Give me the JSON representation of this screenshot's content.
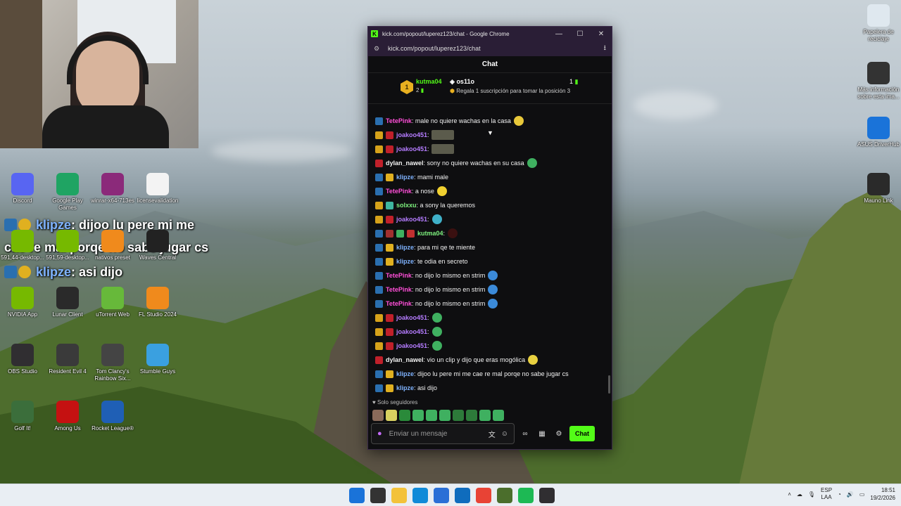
{
  "overlay": {
    "lines": [
      {
        "user": "klipze",
        "text": ": dijoo lu pere mi me"
      },
      {
        "user": "",
        "text": "cae re mal porqe no sabe jugar cs"
      },
      {
        "user": "klipze",
        "text": ": asi dijo"
      }
    ]
  },
  "desktop_icons": {
    "left": [
      {
        "label": "Discord",
        "icon": "discord-icon",
        "color": "#5865f2"
      },
      {
        "label": "Google Play Games",
        "icon": "play-games-icon",
        "color": "#1fa463"
      },
      {
        "label": "winrar-x64-713es",
        "icon": "winrar-icon",
        "color": "#8b2a7a"
      },
      {
        "label": "licensevalidation",
        "icon": "document-icon",
        "color": "#f3f3f3"
      },
      {
        "label": "591,44-desktop...",
        "icon": "nvidia-icon",
        "color": "#76b900"
      },
      {
        "label": "591,59-desktop...",
        "icon": "nvidia-icon",
        "color": "#76b900"
      },
      {
        "label": "nativos preset",
        "icon": "fl-preset-icon",
        "color": "#f08a1c"
      },
      {
        "label": "Waves Central",
        "icon": "waves-icon",
        "color": "#222222"
      },
      {
        "label": "NVIDIA App",
        "icon": "nvidia-icon",
        "color": "#76b900"
      },
      {
        "label": "Lunar Client",
        "icon": "lunar-client-icon",
        "color": "#2a2a2a"
      },
      {
        "label": "uTorrent Web",
        "icon": "utorrent-icon",
        "color": "#67b93a"
      },
      {
        "label": "FL Studio 2024",
        "icon": "fl-studio-icon",
        "color": "#f08a1c"
      },
      {
        "label": "OBS Studio",
        "icon": "obs-icon",
        "color": "#302e31"
      },
      {
        "label": "Resident Evil 4",
        "icon": "re4-icon",
        "color": "#3a3a3a"
      },
      {
        "label": "Tom Clancy's Rainbow Six...",
        "icon": "r6-icon",
        "color": "#444444"
      },
      {
        "label": "Stumble Guys",
        "icon": "stumble-guys-icon",
        "color": "#3aa0e0"
      },
      {
        "label": "Golf It!",
        "icon": "golf-it-icon",
        "color": "#3b6e3b"
      },
      {
        "label": "Among Us",
        "icon": "among-us-icon",
        "color": "#c51111"
      },
      {
        "label": "Rocket League®",
        "icon": "rocket-league-icon",
        "color": "#1f5fb5"
      }
    ],
    "right": [
      {
        "label": "Papelera de reciclaje",
        "icon": "recycle-bin-icon",
        "color": "#dfe8ef"
      },
      {
        "label": "Más información sobre esta ima...",
        "icon": "spotlight-icon",
        "color": "#333333"
      },
      {
        "label": "ASUS DriverHub",
        "icon": "asus-driverhub-icon",
        "color": "#1a73d9"
      },
      {
        "label": "Mauno Link",
        "icon": "mauno-link-icon",
        "color": "#2a2a2a"
      }
    ]
  },
  "browser": {
    "title": "kick.com/popout/luperez123/chat - Google Chrome",
    "url": "kick.com/popout/luperez123/chat",
    "chat_title": "Chat",
    "leaderboard": {
      "first_name": "kutma04",
      "first_count": "2",
      "rank": "1",
      "second_name": "os11o",
      "second_count": "1",
      "promo": "Regala 1 suscripción para tomar la posición 3"
    },
    "messages": [
      {
        "badges": [
          "mod"
        ],
        "user": "TetePink",
        "color": "#ff4fd8",
        "text": ": male no quiere wachas en la casa",
        "emote": "#e8c83a"
      },
      {
        "badges": [
          "crown",
          "gift"
        ],
        "user": "joakoo451",
        "color": "#b57cff",
        "text": ":",
        "emote_sq": true
      },
      {
        "badges": [
          "crown",
          "gift"
        ],
        "user": "joakoo451",
        "color": "#b57cff",
        "text": ":",
        "emote_sq": true
      },
      {
        "badges": [
          "gift"
        ],
        "user": "dylan_nawel",
        "color": "#f2f2f2",
        "text": ": sony no quiere wachas en su casa",
        "emote": "#3fb060"
      },
      {
        "badges": [
          "mod",
          "sub"
        ],
        "user": "klipze",
        "color": "#7fb3ff",
        "text": ": mami male"
      },
      {
        "badges": [
          "mod"
        ],
        "user": "TetePink",
        "color": "#ff4fd8",
        "text": ": a nose",
        "emote": "#f0d030"
      },
      {
        "badges": [
          "crown",
          "og"
        ],
        "user": "solxxu",
        "color": "#7ef27e",
        "text": ": a sony la queremos"
      },
      {
        "badges": [
          "crown",
          "gift"
        ],
        "user": "joakoo451",
        "color": "#b57cff",
        "text": ":",
        "emote": "#3fb0c8"
      },
      {
        "badges": [
          "mod",
          "ring",
          "em",
          "vip"
        ],
        "user": "kutma04",
        "color": "#7ef27e",
        "text": ":",
        "emote": "#3a1010"
      },
      {
        "badges": [
          "mod",
          "sub"
        ],
        "user": "klipze",
        "color": "#7fb3ff",
        "text": ": para mi qe te miente"
      },
      {
        "badges": [
          "mod",
          "sub"
        ],
        "user": "klipze",
        "color": "#7fb3ff",
        "text": ": te odia en secreto"
      },
      {
        "badges": [
          "mod"
        ],
        "user": "TetePink",
        "color": "#ff4fd8",
        "text": ": no dijo lo mismo en strim",
        "emote": "#3b8ad9"
      },
      {
        "badges": [
          "mod"
        ],
        "user": "TetePink",
        "color": "#ff4fd8",
        "text": ": no dijo lo mismo en strim",
        "emote": "#3b8ad9"
      },
      {
        "badges": [
          "mod"
        ],
        "user": "TetePink",
        "color": "#ff4fd8",
        "text": ": no dijo lo mismo en strim",
        "emote": "#3b8ad9"
      },
      {
        "badges": [
          "crown",
          "gift"
        ],
        "user": "joakoo451",
        "color": "#b57cff",
        "text": ":",
        "emote": "#3fb060"
      },
      {
        "badges": [
          "crown",
          "gift"
        ],
        "user": "joakoo451",
        "color": "#b57cff",
        "text": ":",
        "emote": "#3fb060"
      },
      {
        "badges": [
          "crown",
          "gift"
        ],
        "user": "joakoo451",
        "color": "#b57cff",
        "text": ":",
        "emote": "#3fb060"
      },
      {
        "badges": [
          "gift"
        ],
        "user": "dylan_nawel",
        "color": "#f2f2f2",
        "text": ": vio un clip y dijo que eras mogólica",
        "emote": "#e8d040"
      },
      {
        "badges": [
          "mod",
          "sub"
        ],
        "user": "klipze",
        "color": "#7fb3ff",
        "text": ": dijoo lu pere mi me cae re mal porqe no sabe jugar cs"
      },
      {
        "badges": [
          "mod",
          "sub"
        ],
        "user": "klipze",
        "color": "#7fb3ff",
        "text": ": asi dijo"
      }
    ],
    "followers_only": "Solo seguidores",
    "input_placeholder": "Enviar un mensaje",
    "send_label": "Chat"
  },
  "taskbar": {
    "apps": [
      {
        "icon": "windows-start-icon",
        "color": "#1a73d9"
      },
      {
        "icon": "search-icon",
        "color": "#333333"
      },
      {
        "icon": "file-explorer-icon",
        "color": "#f3c23a"
      },
      {
        "icon": "edge-icon",
        "color": "#0f8ad8"
      },
      {
        "icon": "store-icon",
        "color": "#2a6fd6"
      },
      {
        "icon": "outlook-icon",
        "color": "#0f6cbd"
      },
      {
        "icon": "chrome-icon",
        "color": "#e84335"
      },
      {
        "icon": "minecraft-icon",
        "color": "#4b6e2c"
      },
      {
        "icon": "spotify-icon",
        "color": "#1db954"
      },
      {
        "icon": "obs-icon",
        "color": "#302e31"
      }
    ],
    "lang_top": "ESP",
    "lang_bottom": "LAA",
    "time": "18:51",
    "date": "19/2/2026"
  }
}
